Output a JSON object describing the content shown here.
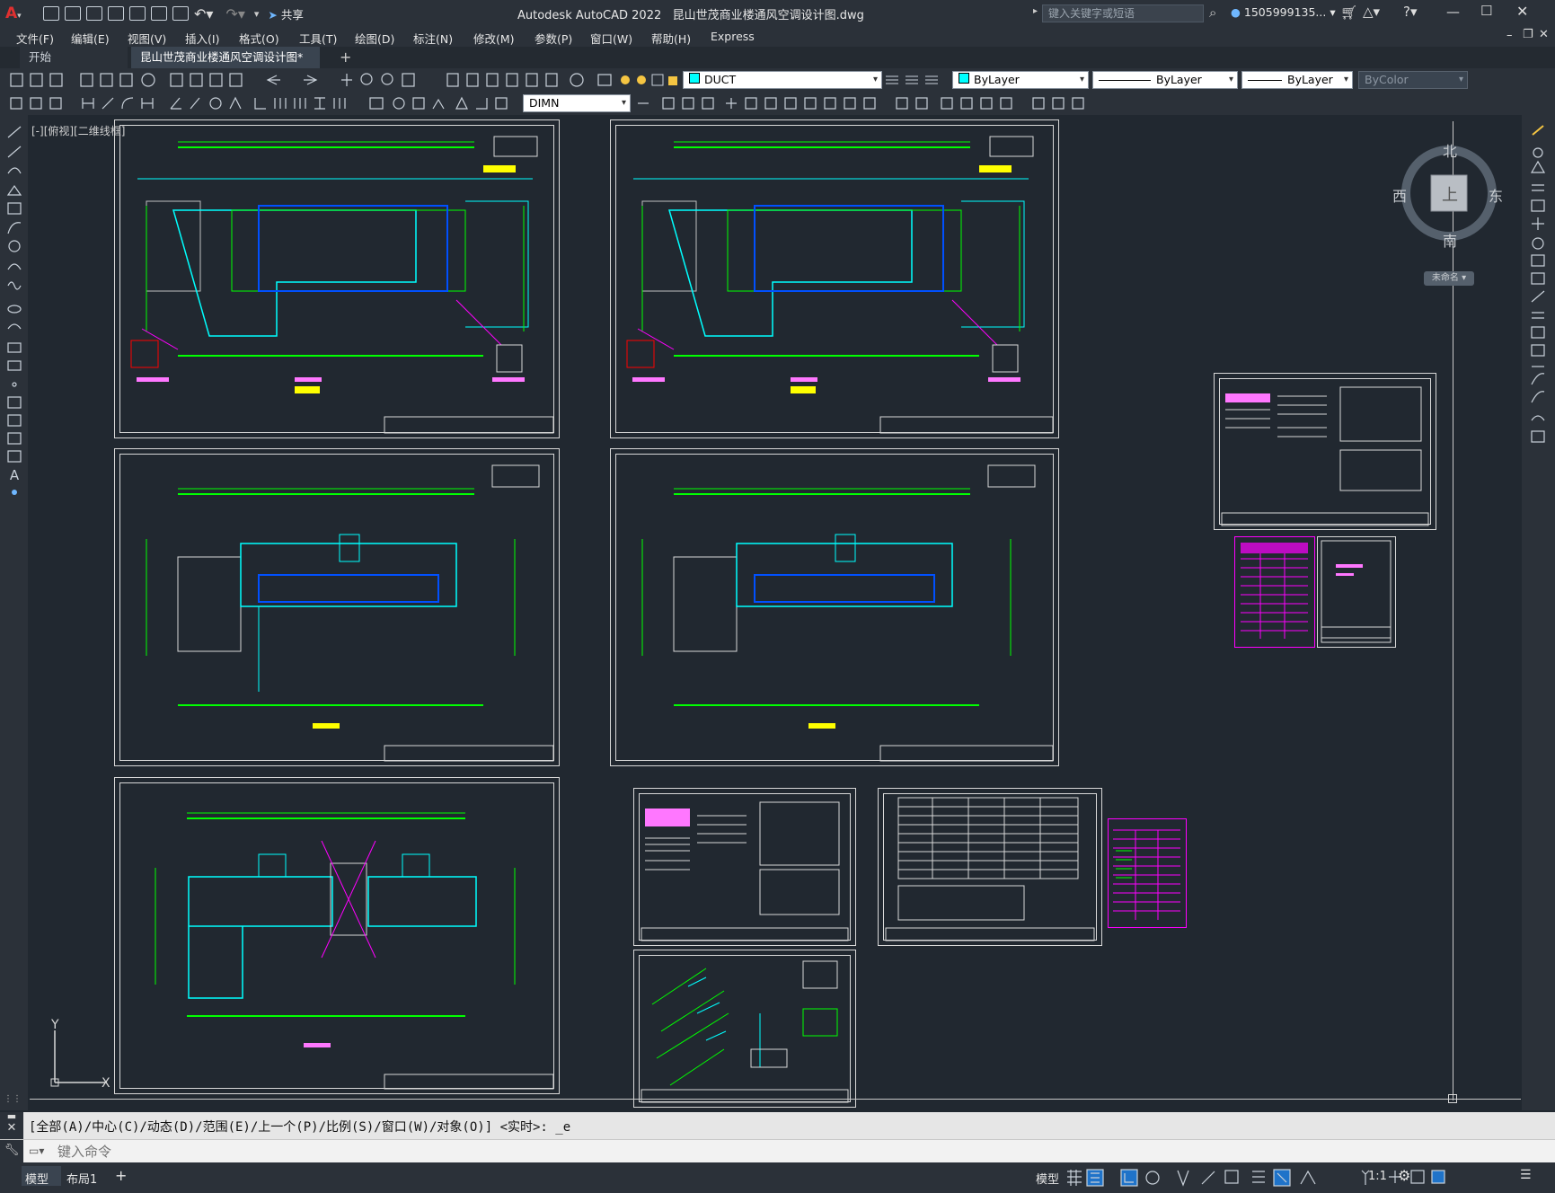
{
  "app_title": "Autodesk AutoCAD 2022",
  "file_name": "昆山世茂商业楼通风空调设计图.dwg",
  "search_placeholder": "键入关键字或短语",
  "user": "1505999135...",
  "share_label": "共享",
  "menu": [
    "文件(F)",
    "编辑(E)",
    "视图(V)",
    "插入(I)",
    "格式(O)",
    "工具(T)",
    "绘图(D)",
    "标注(N)",
    "修改(M)",
    "参数(P)",
    "窗口(W)",
    "帮助(H)",
    "Express"
  ],
  "tabs": {
    "start": "开始",
    "doc": "昆山世茂商业楼通风空调设计图*"
  },
  "layer": "DUCT",
  "properties": {
    "color": "ByLayer",
    "linetype": "ByLayer",
    "lineweight": "ByLayer",
    "plotstyle": "ByColor"
  },
  "dimstyle": "DIMN",
  "viewport_label": "[-][俯视][二维线框]",
  "viewcube": {
    "north": "北",
    "south": "南",
    "east": "东",
    "west": "西",
    "top": "上",
    "wcs": "未命名"
  },
  "ucs": {
    "y": "Y",
    "x": "X"
  },
  "command_history": "[全部(A)/中心(C)/动态(D)/范围(E)/上一个(P)/比例(S)/窗口(W)/对象(O)] <实时>: _e",
  "command_placeholder": "键入命令",
  "layout_tabs": [
    "模型",
    "布局1"
  ],
  "status": {
    "model": "模型",
    "scale": "1:1"
  },
  "colors": {
    "accent": "#1f73c9",
    "cyan": "#00ffff",
    "green": "#00ff00",
    "magenta": "#ff00ff"
  }
}
